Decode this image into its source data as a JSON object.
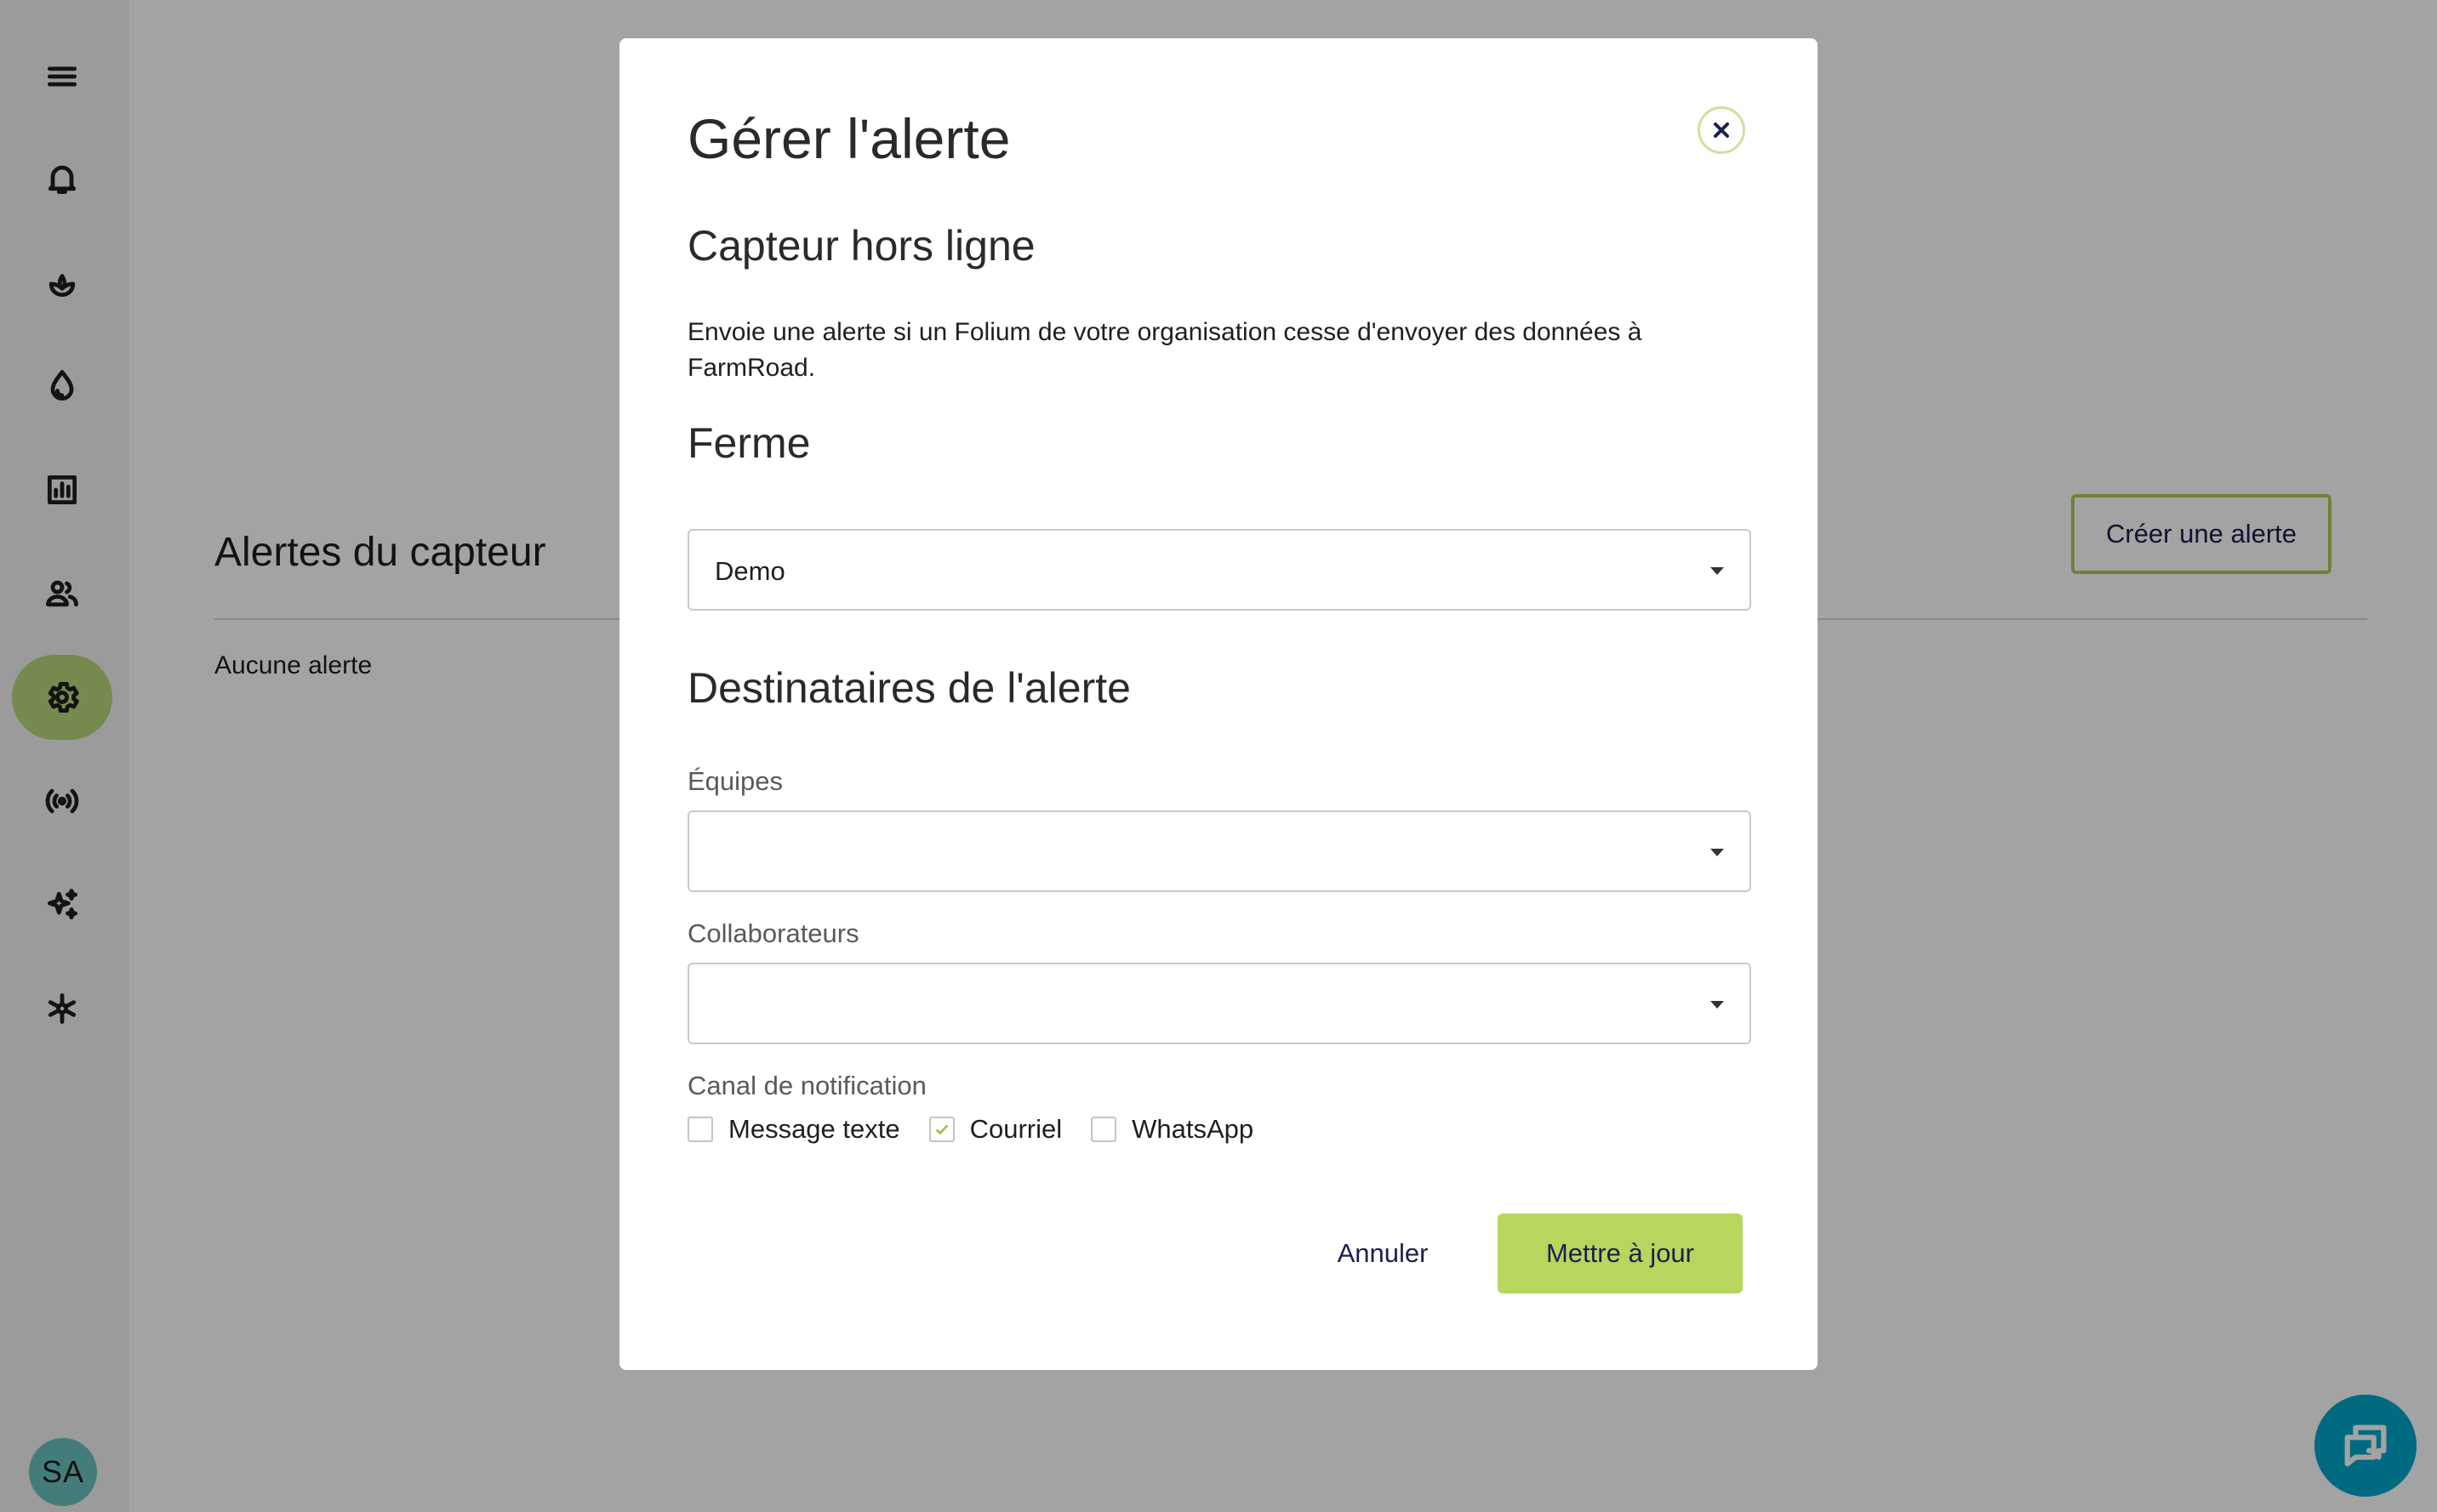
{
  "sidebar": {
    "items": [
      {
        "icon": "menu-icon"
      },
      {
        "icon": "bell-icon"
      },
      {
        "icon": "plant-icon"
      },
      {
        "icon": "water-drop-icon"
      },
      {
        "icon": "chart-icon"
      },
      {
        "icon": "people-icon"
      },
      {
        "icon": "gear-icon",
        "active": true
      },
      {
        "icon": "broadcast-icon"
      },
      {
        "icon": "sparkles-icon"
      },
      {
        "icon": "network-icon"
      }
    ],
    "avatar_initials": "SA"
  },
  "page": {
    "title": "Alertes du capteur",
    "empty_message": "Aucune alerte",
    "create_button": "Créer une alerte"
  },
  "modal": {
    "title": "Gérer l'alerte",
    "alert_type": "Capteur hors ligne",
    "description": "Envoie une alerte si un Folium de votre organisation cesse d'envoyer des données à FarmRoad.",
    "farm_section": "Ferme",
    "farm_value": "Demo",
    "recipients_section": "Destinataires de l'alerte",
    "teams_label": "Équipes",
    "teams_value": "",
    "collaborators_label": "Collaborateurs",
    "collaborators_value": "",
    "channel_label": "Canal de notification",
    "channels": [
      {
        "label": "Message texte",
        "checked": false
      },
      {
        "label": "Courriel",
        "checked": true
      },
      {
        "label": "WhatsApp",
        "checked": false
      }
    ],
    "cancel_button": "Annuler",
    "update_button": "Mettre à jour"
  },
  "colors": {
    "accent": "#b6d65d",
    "active_nav": "#b9d77a",
    "chat": "#00a6c8",
    "button_text": "#1b1f4d"
  }
}
